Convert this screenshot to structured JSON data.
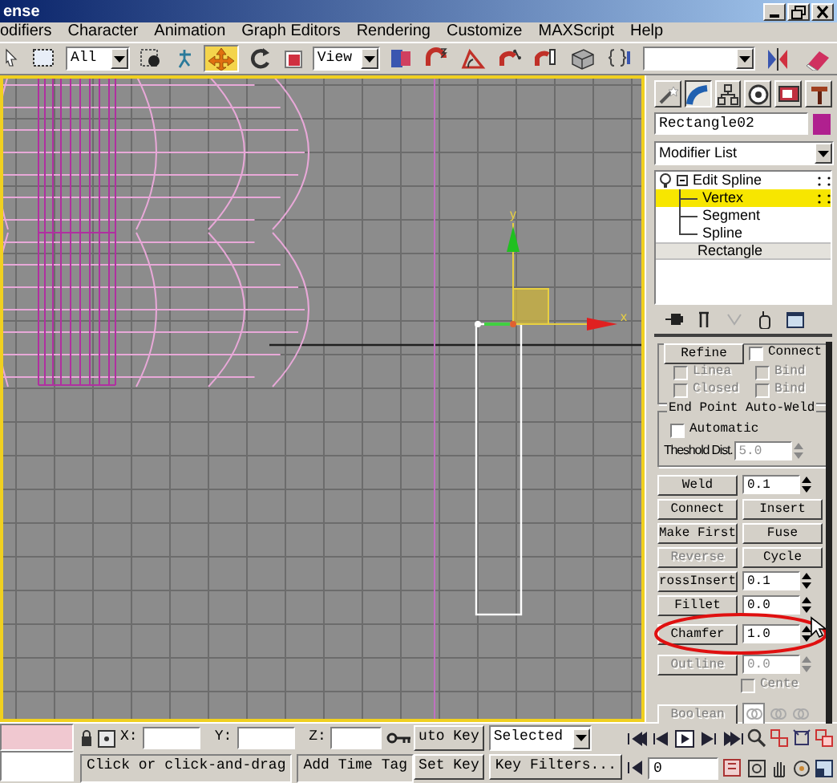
{
  "window": {
    "title": "ense"
  },
  "menu": [
    "odifiers",
    "Character",
    "Animation",
    "Graph Editors",
    "Rendering",
    "Customize",
    "MAXScript",
    "Help"
  ],
  "toolbar": {
    "selection_filter": "All",
    "reference_coord": "View",
    "move_selected": true
  },
  "viewport": {
    "axis_labels": [
      "y",
      "x"
    ]
  },
  "command_panel": {
    "tabs": [
      {
        "selected": false
      },
      {
        "selected": true
      },
      {
        "selected": false
      },
      {
        "selected": false
      },
      {
        "selected": false
      },
      {
        "selected": false
      }
    ],
    "object_name": "Rectangle02",
    "modifier_list": "Modifier List",
    "stack": [
      {
        "label": "Edit Spline",
        "selected": false,
        "expanded": true,
        "children": [
          {
            "label": "Vertex",
            "selected": true
          },
          {
            "label": "Segment",
            "selected": false
          },
          {
            "label": "Spline",
            "selected": false
          }
        ]
      },
      {
        "label": "Rectangle",
        "selected": false
      }
    ],
    "rollout": {
      "groups": [
        {
          "rows": [
            {
              "kind": "button_check",
              "button": "Refine",
              "check": "Connect",
              "checked": false
            },
            {
              "kind": "check_pair",
              "items": [
                {
                  "label": "Linea",
                  "checked": false,
                  "disabled": true
                },
                {
                  "label": "Bind",
                  "checked": false,
                  "disabled": true
                }
              ]
            },
            {
              "kind": "check_pair",
              "items": [
                {
                  "label": "Closed",
                  "checked": false,
                  "disabled": true
                },
                {
                  "label": "Bind",
                  "checked": false,
                  "disabled": true
                }
              ]
            }
          ]
        },
        {
          "title": "End Point Auto-Weld",
          "rows": [
            {
              "kind": "check",
              "label": "Automatic",
              "checked": false,
              "disabled": false
            },
            {
              "kind": "label_spinner",
              "label": "Theshold Dist.",
              "value": "5.0",
              "disabled": true
            }
          ]
        }
      ],
      "rows": [
        {
          "kind": "button_spinner",
          "button": "Weld",
          "value": "0.1",
          "disabled": false,
          "circled": false
        },
        {
          "kind": "button_pair",
          "buttons": [
            {
              "label": "Connect",
              "disabled": false
            },
            {
              "label": "Insert",
              "disabled": false
            }
          ],
          "circled": false
        },
        {
          "kind": "button_pair",
          "buttons": [
            {
              "label": "Make First",
              "disabled": false
            },
            {
              "label": "Fuse",
              "disabled": false
            }
          ],
          "circled": false
        },
        {
          "kind": "button_pair",
          "buttons": [
            {
              "label": "Reverse",
              "disabled": true
            },
            {
              "label": "Cycle",
              "disabled": false
            }
          ],
          "circled": false
        },
        {
          "kind": "button_spinner",
          "button": "rossInsert",
          "value": "0.1",
          "disabled": false,
          "circled": false
        },
        {
          "kind": "button_spinner",
          "button": "Fillet",
          "value": "0.0",
          "disabled": false,
          "circled": false
        },
        {
          "kind": "button_spinner",
          "button": "Chamfer",
          "value": "1.0",
          "disabled": false,
          "circled": true
        },
        {
          "kind": "button_spinner",
          "button": "Outline",
          "value": "0.0",
          "disabled": true,
          "circled": false
        },
        {
          "kind": "check",
          "label": "Cente",
          "checked": false,
          "disabled": true,
          "circled": false
        },
        {
          "kind": "boolean",
          "button": "Boolean",
          "disabled": true,
          "circled": false
        }
      ]
    }
  },
  "bottom_bar": {
    "coordinates": [
      "X:",
      "Y:",
      "Z:"
    ],
    "auto_key": "uto Key",
    "key_mode": "Selected",
    "set_key": "Set Key",
    "key_filters": "Key Filters...",
    "frame": "0",
    "status": "Click or click-and-drag",
    "time_tag": "Add Time Tag"
  }
}
